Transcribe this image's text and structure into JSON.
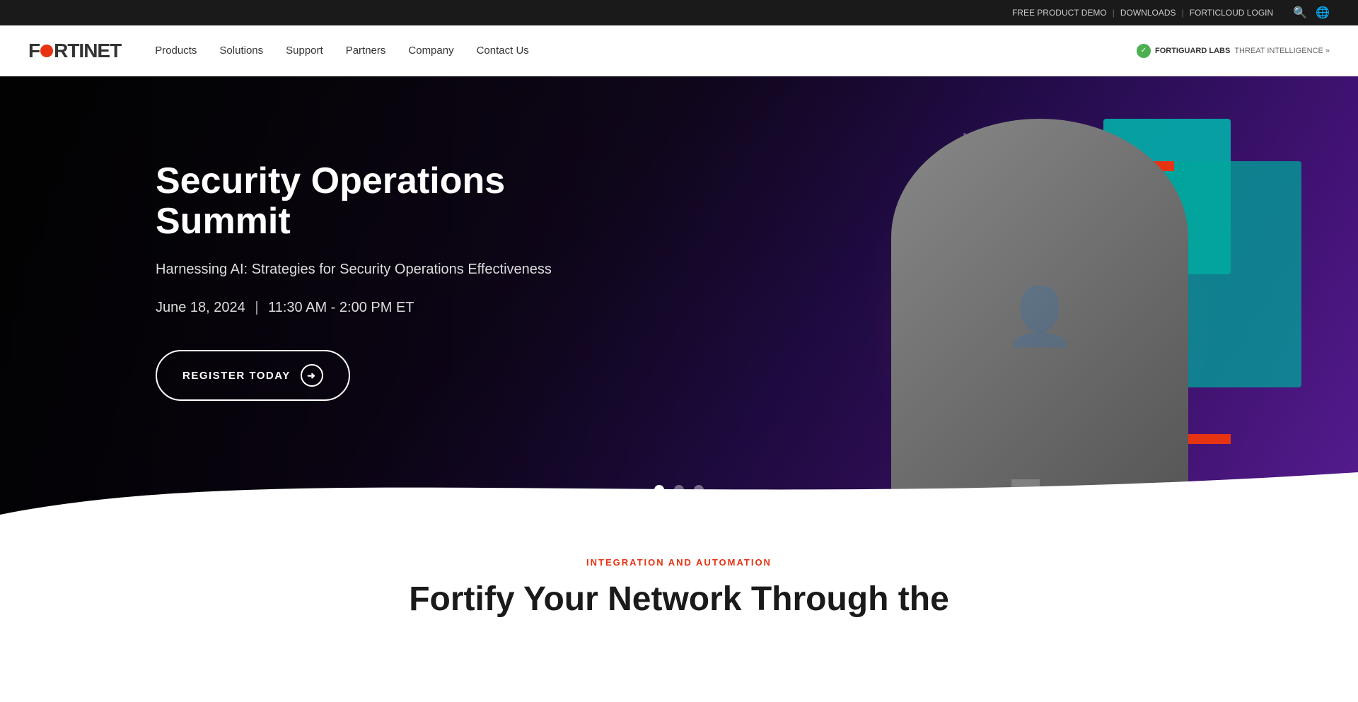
{
  "topbar": {
    "links": [
      {
        "label": "FREE PRODUCT DEMO"
      },
      {
        "label": "DOWNLOADS"
      },
      {
        "label": "FORTICLOUD LOGIN"
      }
    ]
  },
  "nav": {
    "logo": {
      "prefix": "F",
      "suffix": "RTINET"
    },
    "links": [
      {
        "label": "Products"
      },
      {
        "label": "Solutions"
      },
      {
        "label": "Support"
      },
      {
        "label": "Partners"
      },
      {
        "label": "Company"
      },
      {
        "label": "Contact Us"
      }
    ],
    "fortiguard": {
      "label": "FORTIGUARD LABS",
      "suffix": "THREAT INTELLIGENCE »"
    }
  },
  "hero": {
    "title": "Security Operations Summit",
    "subtitle": "Harnessing AI: Strategies for Security Operations Effectiveness",
    "date": "June 18, 2024",
    "time": "11:30 AM - 2:00 PM ET",
    "cta": "REGISTER TODAY"
  },
  "slides": {
    "total": 3,
    "active": 0
  },
  "below_hero": {
    "tag": "INTEGRATION AND AUTOMATION",
    "title": "Fortify Your Network Through the"
  }
}
